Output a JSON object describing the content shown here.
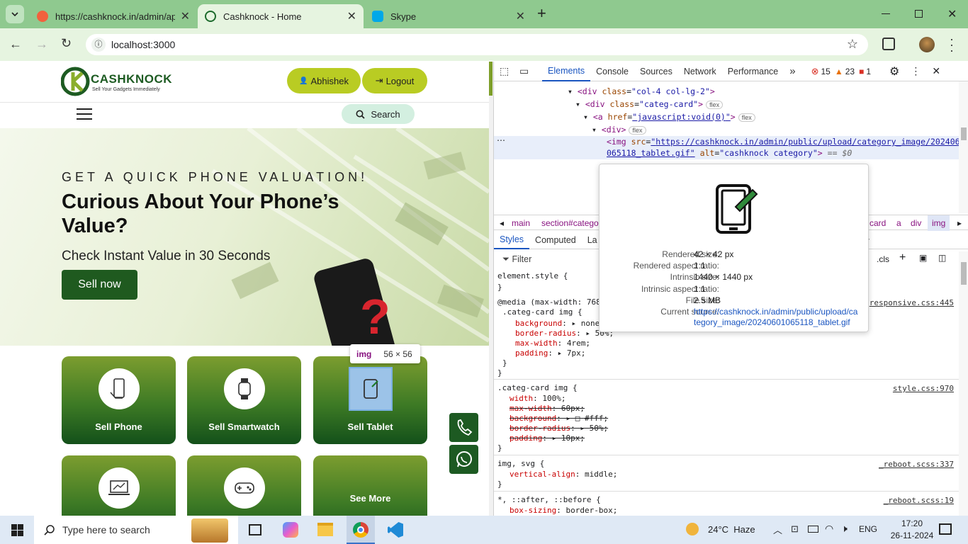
{
  "browser": {
    "tabs": [
      {
        "title": "https://cashknock.in/admin/ap",
        "fav_color": "#f2613d"
      },
      {
        "title": "Cashknock - Home",
        "fav_color": "#1d6b2d"
      },
      {
        "title": "Skype",
        "fav_color": "#00a8e8"
      }
    ],
    "new_tab": "+",
    "url": "localhost:3000"
  },
  "site": {
    "logo_text": "CASHKNOCK",
    "logo_tagline": "Sell Your Gadgets Immediately",
    "user_button": "Abhishek",
    "logout_button": "Logout",
    "search_button": "Search",
    "hero": {
      "kicker": "GET A QUICK PHONE VALUATION!",
      "title_line1": "Curious About Your Phone’s",
      "title_line2": "Value?",
      "subtitle": "Check Instant Value in 30 Seconds",
      "cta": "Sell now"
    },
    "categories": [
      {
        "label": "Sell Phone",
        "icon": "phone-icon"
      },
      {
        "label": "Sell Smartwatch",
        "icon": "smartwatch-icon"
      },
      {
        "label": "Sell Tablet",
        "icon": "tablet-icon"
      },
      {
        "label": "",
        "icon": "laptop-icon"
      },
      {
        "label": "",
        "icon": "gaming-console-icon"
      },
      {
        "label": "See More",
        "icon": ""
      }
    ],
    "inspect_badge": {
      "tag": "img",
      "size": "56 × 56"
    }
  },
  "devtools": {
    "tabs": [
      "Elements",
      "Console",
      "Sources",
      "Network",
      "Performance"
    ],
    "errors": "15",
    "warnings": "23",
    "infos": "1",
    "dom": {
      "line1_attr": "col-4 col-lg-2",
      "line2_attr": "categ-card",
      "line3_href": "javascript:void(0)",
      "img_src": "https://cashknock.in/admin/public/upload/category_image/20240601",
      "img_src2": "065118_tablet.gif",
      "img_alt": "cashknock category",
      "eq": "== $0",
      "flex": "flex"
    },
    "breadcrumbs": [
      "main",
      "section#catego",
      "card",
      "a",
      "div",
      "img"
    ],
    "sub_tabs": [
      "Styles",
      "Computed",
      "La",
      "ty"
    ],
    "filter_placeholder": "Filter",
    "cls": ".cls",
    "rules": {
      "element_style": "element.style {",
      "media": "@media (max-width: 768",
      "responsive_src": "responsive.css:445",
      "r1_selector": ".categ-card img {",
      "r1_props": [
        {
          "p": "background",
          "v": "none;"
        },
        {
          "p": "border-radius",
          "v": "50%;"
        },
        {
          "p": "max-width",
          "v": "4rem;"
        },
        {
          "p": "padding",
          "v": "7px;"
        }
      ],
      "r2_selector": ".categ-card img {",
      "r2_src": "style.css:970",
      "r2_props": [
        {
          "p": "width",
          "v": "100%;"
        },
        {
          "p": "max-width",
          "v": "60px;"
        },
        {
          "p": "background",
          "v": "#fff;"
        },
        {
          "p": "border-radius",
          "v": "50%;"
        },
        {
          "p": "padding",
          "v": "10px;"
        }
      ],
      "r3_selector": "img, svg {",
      "r3_src": "_reboot.scss:337",
      "r3_prop": "vertical-align",
      "r3_val": "middle;",
      "r4_selector": "*, ::after, ::before {",
      "r4_src": "_reboot.scss:19",
      "r4_prop": "box-sizing",
      "r4_val": "border-box;",
      "close": "}"
    },
    "tooltip": {
      "rendered_size_k": "Rendered size:",
      "rendered_size_v": "42 × 42 px",
      "rendered_ar_k": "Rendered aspect ratio:",
      "rendered_ar_v": "1:1",
      "intrinsic_size_k": "Intrinsic size:",
      "intrinsic_size_v": "1440 × 1440 px",
      "intrinsic_ar_k": "Intrinsic aspect ratio:",
      "intrinsic_ar_v": "1:1",
      "file_size_k": "File size:",
      "file_size_v": "2.5 MB",
      "source_k": "Current source:",
      "source_v1": "https://cashknock.in/admin/public/upload/ca",
      "source_v2": "tegory_image/20240601065118_tablet.gif"
    }
  },
  "taskbar": {
    "search_placeholder": "Type here to search",
    "weather": "24°C  Haze",
    "lang": "ENG",
    "time": "17:20",
    "date": "26-11-2024"
  }
}
